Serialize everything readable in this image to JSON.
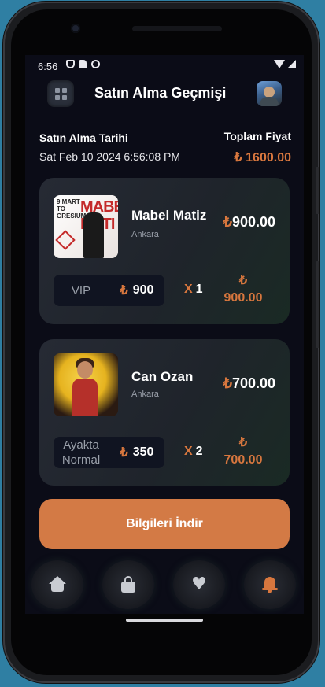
{
  "status_bar": {
    "time": "6:56"
  },
  "header": {
    "title": "Satın Alma Geçmişi"
  },
  "summary": {
    "date_label": "Satın Alma Tarihi",
    "date_value": "Sat Feb 10 2024 6:56:08 PM",
    "total_label": "Toplam Fiyat",
    "total_value": "₺ 1600.00"
  },
  "purchases": [
    {
      "name": "Mabel Matiz",
      "city": "Ankara",
      "price": "900.00",
      "currency": "₺",
      "ticket_type": "VIP",
      "unit_price": "900",
      "qty_prefix": "X",
      "quantity": "1",
      "subtotal_currency": "₺",
      "subtotal": "900.00",
      "poster_text_red": "MABE\nMATI",
      "poster_text_black": "9 MART\nTO\nGRESIUM"
    },
    {
      "name": "Can Ozan",
      "city": "Ankara",
      "price": "700.00",
      "currency": "₺",
      "ticket_type": "Ayakta Normal",
      "unit_price": "350",
      "qty_prefix": "X",
      "quantity": "2",
      "subtotal_currency": "₺",
      "subtotal": "700.00"
    }
  ],
  "download_button": {
    "label": "Bilgileri İndir"
  },
  "bottom_nav": {
    "items": [
      {
        "icon": "home-icon"
      },
      {
        "icon": "shopping-bag-icon"
      },
      {
        "icon": "heart-icon"
      },
      {
        "icon": "bell-icon"
      }
    ],
    "active_index": 3
  },
  "colors": {
    "accent": "#d8773e",
    "background": "#0b0c17",
    "card": "#262a34"
  }
}
